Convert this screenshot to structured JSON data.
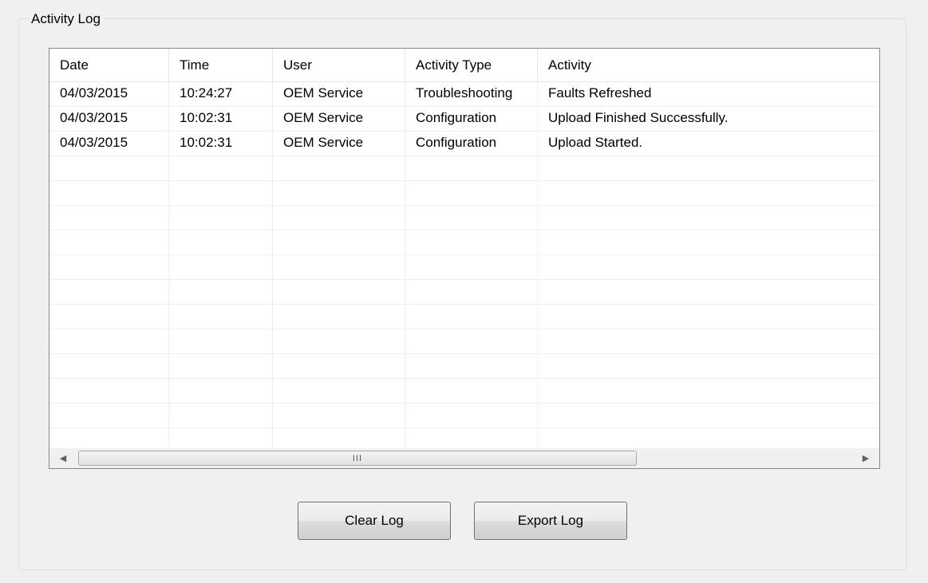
{
  "group": {
    "title": "Activity Log"
  },
  "table": {
    "columns": [
      "Date",
      "Time",
      "User",
      "Activity Type",
      "Activity"
    ],
    "rows": [
      [
        "04/03/2015",
        "10:24:27",
        "OEM Service",
        "Troubleshooting",
        "Faults Refreshed"
      ],
      [
        "04/03/2015",
        "10:02:31",
        "OEM Service",
        "Configuration",
        "Upload Finished Successfully."
      ],
      [
        "04/03/2015",
        "10:02:31",
        "OEM Service",
        "Configuration",
        "Upload Started."
      ]
    ],
    "empty_rows": 12
  },
  "scrollbar": {
    "left_icon": "scroll-left-arrow-icon",
    "right_icon": "scroll-right-arrow-icon",
    "grip": "III"
  },
  "buttons": {
    "clear_label": "Clear Log",
    "export_label": "Export Log"
  }
}
